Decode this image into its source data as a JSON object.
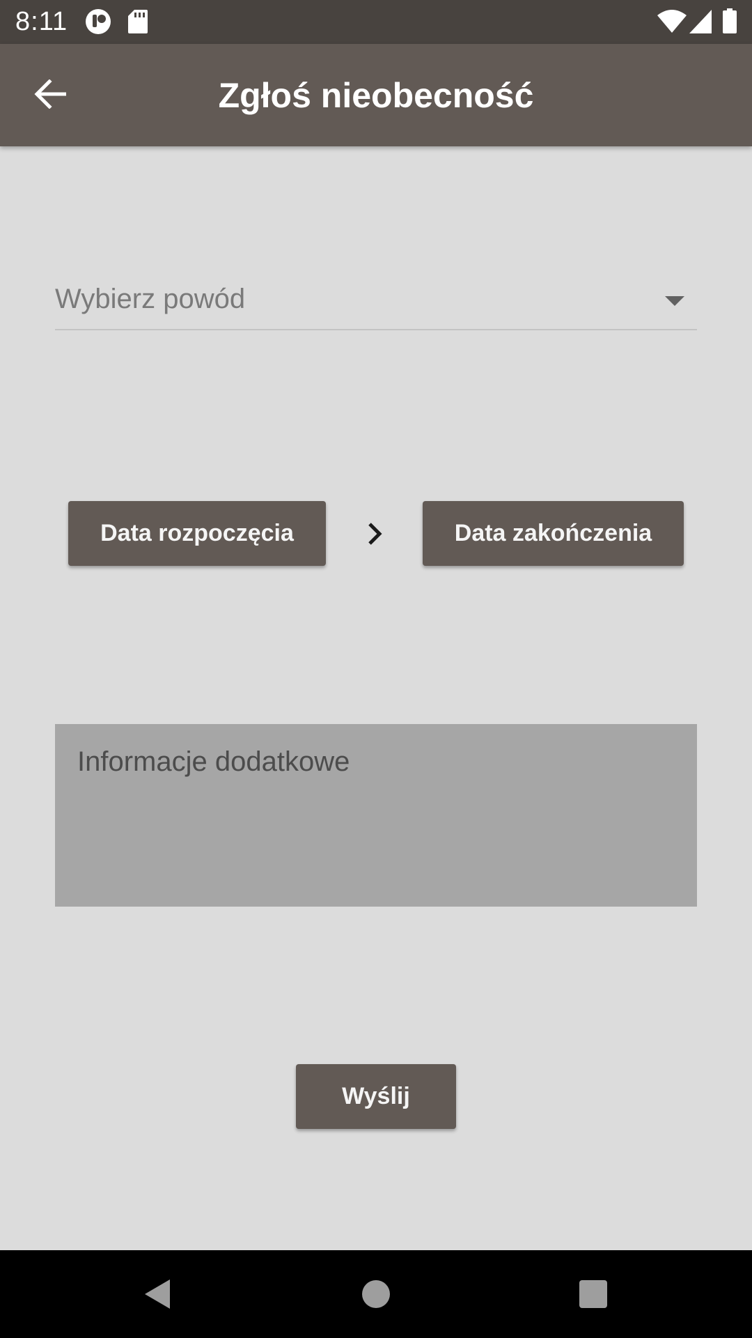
{
  "status_bar": {
    "time": "8:11",
    "icons": [
      "notification-app-icon",
      "sd-card-icon",
      "wifi-icon",
      "signal-icon",
      "battery-icon"
    ]
  },
  "app_bar": {
    "title": "Zgłoś nieobecność",
    "back_icon": "arrow-back-icon"
  },
  "form": {
    "reason_placeholder": "Wybierz powód",
    "start_date_label": "Data rozpoczęcia",
    "end_date_label": "Data zakończenia",
    "info_placeholder": "Informacje dodatkowe",
    "send_label": "Wyślij"
  },
  "nav_bar": {
    "icons": [
      "nav-back-icon",
      "nav-home-icon",
      "nav-recents-icon"
    ]
  },
  "colors": {
    "status_bar": "#48433f",
    "app_bar": "#625a55",
    "background": "#dcdcdc",
    "button": "#625a55",
    "info_field": "#a6a6a6"
  }
}
